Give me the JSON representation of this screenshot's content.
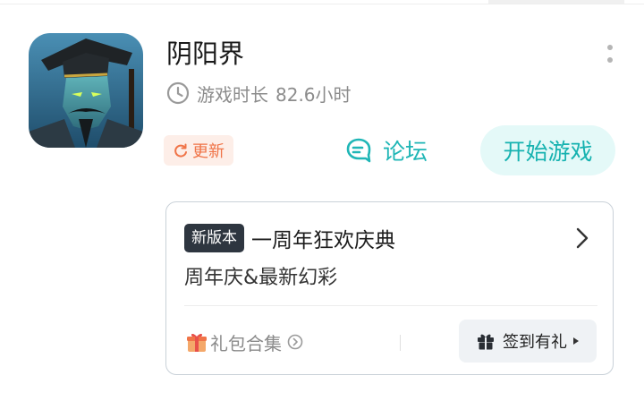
{
  "game": {
    "title": "阴阳界",
    "playtime_label": "游戏时长",
    "playtime_value": "82.6小时"
  },
  "actions": {
    "update_label": "更新",
    "forum_label": "论坛",
    "start_label": "开始游戏"
  },
  "event_card": {
    "tag": "新版本",
    "title": "一周年狂欢庆典",
    "subtitle": "周年庆&最新幻彩",
    "gift_set_label": "礼包合集",
    "checkin_label": "签到有礼"
  },
  "colors": {
    "accent_teal": "#16b2b0",
    "update_orange": "#f07448",
    "tag_dark": "#2e3640"
  },
  "icons": {
    "clock": "clock-icon",
    "refresh": "refresh-icon",
    "forum": "chat-bubble-icon",
    "more": "more-vertical-icon",
    "chevron": "chevron-right-icon",
    "gift_emoji": "gift-emoji-icon",
    "circle_arrow": "circle-arrow-right-icon",
    "gift": "gift-icon",
    "triangle": "triangle-right-icon"
  }
}
